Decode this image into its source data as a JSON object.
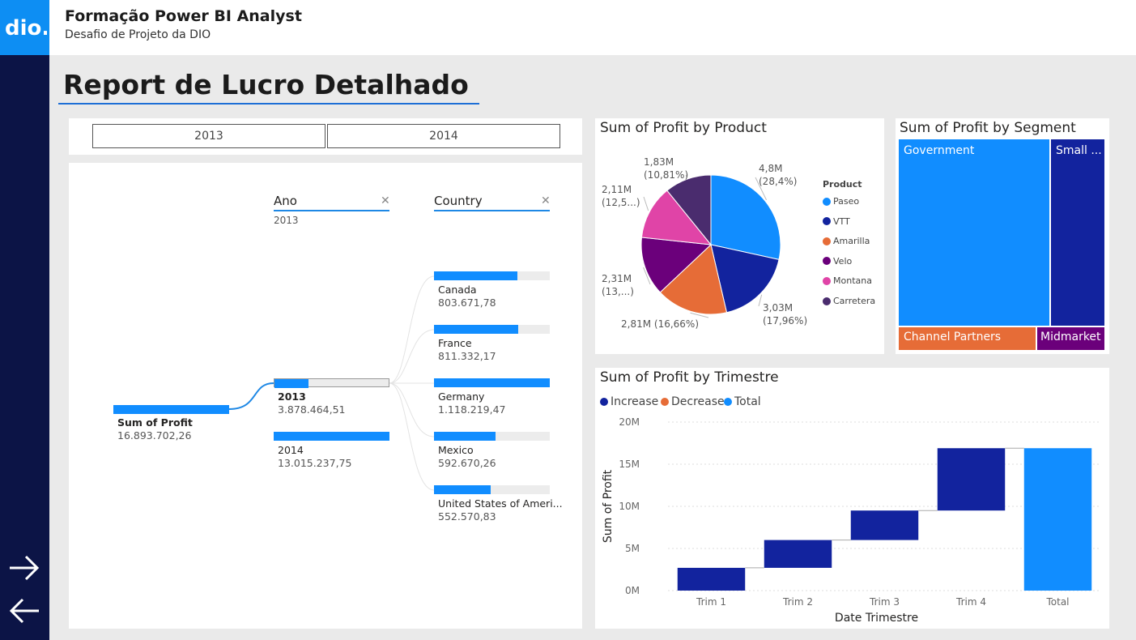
{
  "header": {
    "logo_text": "dio.",
    "title": "Formação Power BI Analyst",
    "subtitle": "Desafio de Projeto da DIO"
  },
  "nav": {
    "forward_icon": "arrow-right-icon",
    "back_icon": "arrow-left-icon"
  },
  "page": {
    "title": "Report de Lucro Detalhado",
    "accent": "#1e6fd6"
  },
  "slicer": {
    "years": [
      "2013",
      "2014"
    ]
  },
  "decomposition": {
    "root": {
      "label": "Sum of Profit",
      "value": "16.893.702,26"
    },
    "level1": {
      "header": "Ano",
      "filter": "2013",
      "items": [
        {
          "label": "2013",
          "value": "3.878.464,51",
          "fraction": 0.3,
          "selected": true
        },
        {
          "label": "2014",
          "value": "13.015.237,75",
          "fraction": 1.0,
          "selected": false
        }
      ]
    },
    "level2": {
      "header": "Country",
      "items": [
        {
          "label": "Canada",
          "value": "803.671,78",
          "fraction": 0.72
        },
        {
          "label": "France",
          "value": "811.332,17",
          "fraction": 0.73
        },
        {
          "label": "Germany",
          "value": "1.118.219,47",
          "fraction": 1.0
        },
        {
          "label": "Mexico",
          "value": "592.670,26",
          "fraction": 0.53
        },
        {
          "label": "United States of Ameri...",
          "value": "552.570,83",
          "fraction": 0.49
        }
      ]
    },
    "close_icon": "close-icon"
  },
  "chart_data": [
    {
      "type": "pie",
      "title": "Sum of Profit by Product",
      "legend_title": "Product",
      "legend_position": "right",
      "slices": [
        {
          "name": "Paseo",
          "value": 4.8,
          "label": "4,8M",
          "pct": "(28,4%)",
          "color": "#118dff"
        },
        {
          "name": "VTT",
          "value": 3.03,
          "label": "3,03M",
          "pct": "(17,96%)",
          "color": "#12239e"
        },
        {
          "name": "Amarilla",
          "value": 2.81,
          "label": "2,81M (16,66%)",
          "pct": "",
          "color": "#e66c37"
        },
        {
          "name": "Velo",
          "value": 2.31,
          "label": "2,31M",
          "pct": "(13,...)",
          "color": "#6b007b"
        },
        {
          "name": "Montana",
          "value": 2.11,
          "label": "2,11M",
          "pct": "(12,5...)",
          "color": "#e044a7"
        },
        {
          "name": "Carretera",
          "value": 1.83,
          "label": "1,83M",
          "pct": "(10,81%)",
          "color": "#4a2c6e"
        }
      ]
    },
    {
      "type": "treemap",
      "title": "Sum of Profit by Segment",
      "segments": [
        {
          "name": "Government",
          "label": "Government",
          "color": "#118dff"
        },
        {
          "name": "Small Business",
          "label": "Small ...",
          "color": "#12239e"
        },
        {
          "name": "Channel Partners",
          "label": "Channel Partners",
          "color": "#e66c37"
        },
        {
          "name": "Midmarket",
          "label": "Midmarket",
          "color": "#6b007b"
        }
      ]
    },
    {
      "type": "waterfall",
      "title": "Sum of Profit by Trimestre",
      "xlabel": "Date Trimestre",
      "ylabel": "Sum of Profit",
      "ylim": [
        0,
        20
      ],
      "y_ticks": [
        "0M",
        "5M",
        "10M",
        "15M",
        "20M"
      ],
      "legend": [
        {
          "name": "Increase",
          "color": "#12239e"
        },
        {
          "name": "Decrease",
          "color": "#e66c37"
        },
        {
          "name": "Total",
          "color": "#118dff"
        }
      ],
      "categories": [
        "Trim 1",
        "Trim 2",
        "Trim 3",
        "Trim 4",
        "Total"
      ],
      "increments": [
        2.7,
        3.3,
        3.5,
        7.4
      ],
      "total": 16.9
    }
  ]
}
